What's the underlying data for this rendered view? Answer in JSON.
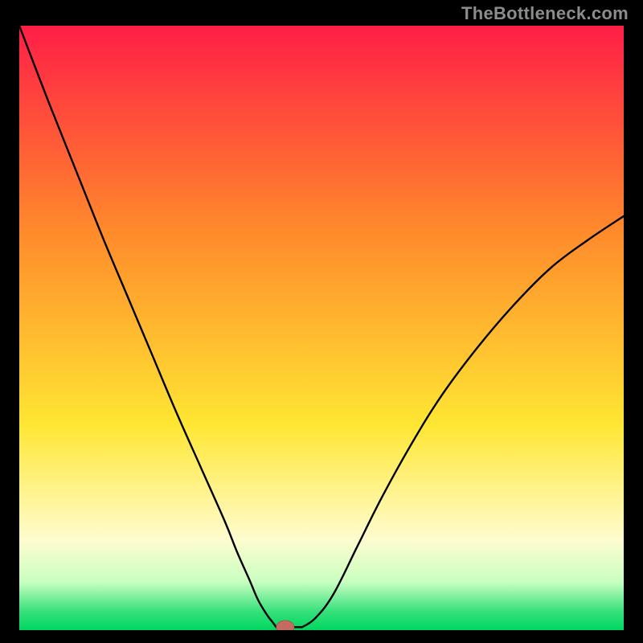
{
  "watermark": {
    "text": "TheBottleneck.com"
  },
  "colors": {
    "background": "#000000",
    "gradient_top": "#ff1e47",
    "gradient_mid1": "#ff8a2b",
    "gradient_mid2": "#ffe633",
    "gradient_low1": "#fffccf",
    "gradient_low2": "#c9ffc0",
    "gradient_low3": "#34e07a",
    "gradient_bottom": "#00d760",
    "curve": "#000000",
    "marker_fill": "#c46a62",
    "marker_stroke": "#9c4a45"
  },
  "chart_data": {
    "type": "line",
    "title": "",
    "xlabel": "",
    "ylabel": "",
    "xlim": [
      0,
      100
    ],
    "ylim": [
      0,
      100
    ],
    "grid": false,
    "series": [
      {
        "name": "bottleneck-curve",
        "x": [
          0,
          5,
          10,
          14,
          18,
          22,
          26,
          30,
          34,
          36,
          38,
          39.5,
          41,
          42,
          43,
          44.5,
          46.5,
          49,
          52,
          56,
          60,
          65,
          70,
          76,
          82,
          88,
          94,
          100
        ],
        "values": [
          100,
          87,
          74.5,
          64.5,
          55,
          45.5,
          36,
          27,
          18,
          13,
          8.5,
          5,
          2.5,
          1.2,
          0.6,
          0.5,
          0.5,
          2,
          6,
          14,
          22,
          31,
          39,
          47,
          54,
          60,
          64.5,
          68.5
        ]
      }
    ],
    "marker": {
      "x": 44,
      "y": 0.5,
      "rx": 1.5,
      "ry": 1.1
    },
    "flat_segment": {
      "x0": 42.5,
      "x1": 46.8,
      "y": 0.5
    }
  }
}
